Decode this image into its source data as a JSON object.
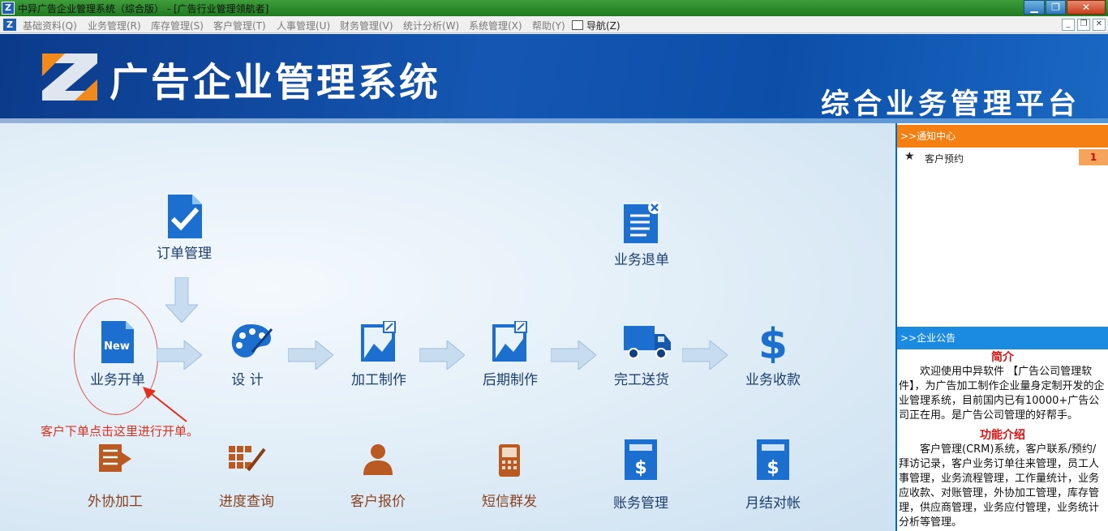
{
  "window": {
    "title": "中异广告企业管理系统（综合版） - [广告行业管理领航者]",
    "controls": {
      "minimize": "▁",
      "maximize": "❐",
      "close": "✕"
    }
  },
  "menu": {
    "items": [
      "基础资料(Q)",
      "业务管理(R)",
      "库存管理(S)",
      "客户管理(T)",
      "人事管理(U)",
      "财务管理(V)",
      "统计分析(W)",
      "系统管理(X)",
      "帮助(Y)"
    ],
    "nav": "导航(Z)",
    "mdi_controls": [
      "_",
      "❐",
      "✕"
    ]
  },
  "banner": {
    "title": "广告企业管理系统",
    "subtitle": "综合业务管理平台",
    "logo_icon": "z-logo"
  },
  "flow": {
    "order_mgmt": "订单管理",
    "return": "业务退单",
    "new_order": "业务开单",
    "new_badge": "New",
    "design": "设 计",
    "production": "加工制作",
    "post_production": "后期制作",
    "delivery": "完工送货",
    "collection": "业务收款",
    "hint": "客户下单点击这里进行开单。"
  },
  "tools": {
    "outsource": "外协加工",
    "progress": "进度查询",
    "quote": "客户报价",
    "sms": "短信群发",
    "finance": "账务管理",
    "reconcile": "月结对帐"
  },
  "notice_center": {
    "header": ">>通知中心",
    "items": [
      {
        "label": "客户预约",
        "count": "1"
      }
    ]
  },
  "announcement": {
    "header": ">>企业公告",
    "intro_title": "简介",
    "intro_text": "欢迎使用中异软件 【广告公司管理软件】，为广告加工制作企业量身定制开发的企业管理系统，目前国内已有10000+广告公司正在用。是广告公司管理的好帮手。",
    "features_title": "功能介绍",
    "features_text": "客户管理(CRM)系统，客户联系/预约/拜访记录，客户业务订单往来管理，员工人事管理，业务流程管理，工作量统计，业务应收款、对账管理，外协加工管理，库存管理，供应商管理，业务应付管理，业务统计分析等管理。"
  },
  "colors": {
    "banner": "#1457b3",
    "notice": "#f57f12",
    "announce": "#1a8be0",
    "hint": "#e0301e"
  }
}
